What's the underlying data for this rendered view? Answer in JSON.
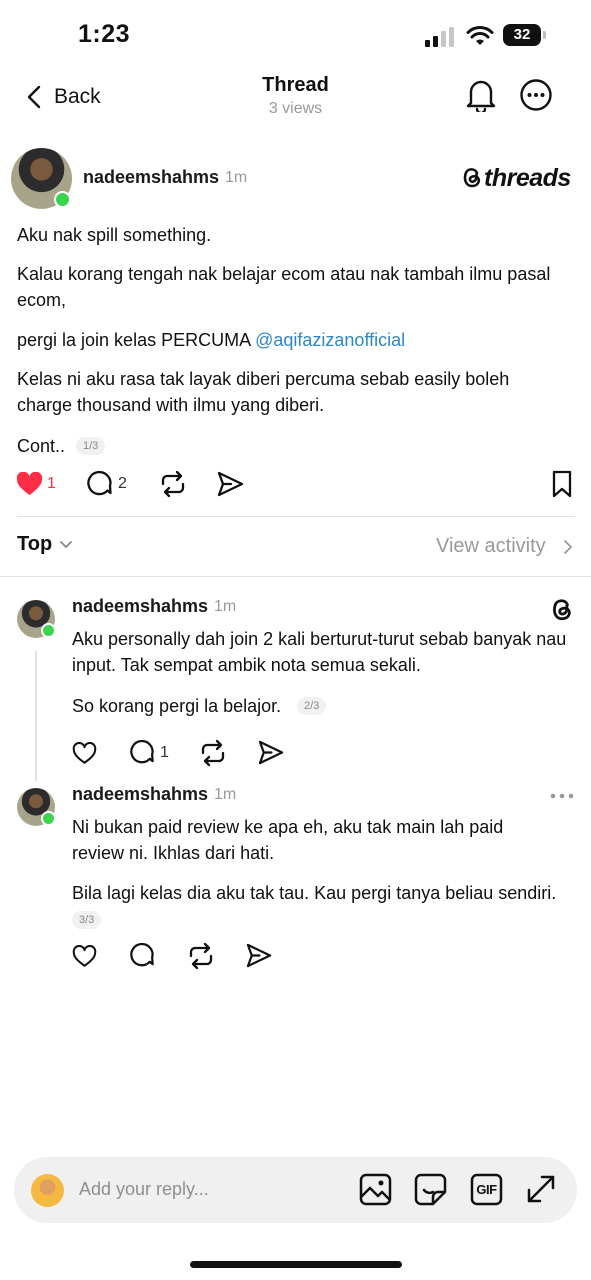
{
  "status_bar": {
    "time": "1:23",
    "battery": "32"
  },
  "header": {
    "back_label": "Back",
    "title": "Thread",
    "subtitle": "3 views"
  },
  "post": {
    "username": "nadeemshahms",
    "time": "1m",
    "brand": "threads",
    "paragraphs": [
      "Aku nak spill something.",
      "Kalau korang tengah nak belajar ecom atau nak tambah ilmu pasal ecom,"
    ],
    "join_text": "pergi la join kelas PERCUMA ",
    "mention": "@aqifazizanofficial",
    "paragraph4": "Kelas ni aku rasa tak layak diberi percuma sebab easily boleh charge thousand with ilmu yang diberi.",
    "cont_text": "Cont..",
    "pager": "1/3",
    "likes": "1",
    "replies": "2"
  },
  "sort": {
    "label": "Top",
    "view_activity": "View activity"
  },
  "replies": [
    {
      "username": "nadeemshahms",
      "time": "1m",
      "paragraphs": [
        "Aku personally dah join 2 kali berturut-turut sebab banyak nau input. Tak sempat ambik nota semua sekali.",
        "So korang pergi la belajor."
      ],
      "pager": "2/3",
      "replies": "1"
    },
    {
      "username": "nadeemshahms",
      "time": "1m",
      "paragraphs": [
        "Ni bukan paid review ke apa eh, aku tak main lah paid review ni. Ikhlas dari hati.",
        "Bila lagi kelas dia aku tak tau. Kau pergi tanya beliau sendiri."
      ],
      "pager": "3/3"
    }
  ],
  "composer": {
    "placeholder": "Add your reply...",
    "gif_label": "GIF"
  },
  "colors": {
    "like": "#ff2d46",
    "mention": "#2f86c7",
    "online": "#3cd34e"
  },
  "icons": [
    "chevron-left-icon",
    "bell-icon",
    "more-icon",
    "threads-logo-icon",
    "heart-icon",
    "comment-icon",
    "repost-icon",
    "share-icon",
    "bookmark-icon",
    "chevron-down-icon",
    "chevron-right-icon",
    "image-icon",
    "sticker-icon",
    "gif-icon",
    "expand-icon"
  ]
}
